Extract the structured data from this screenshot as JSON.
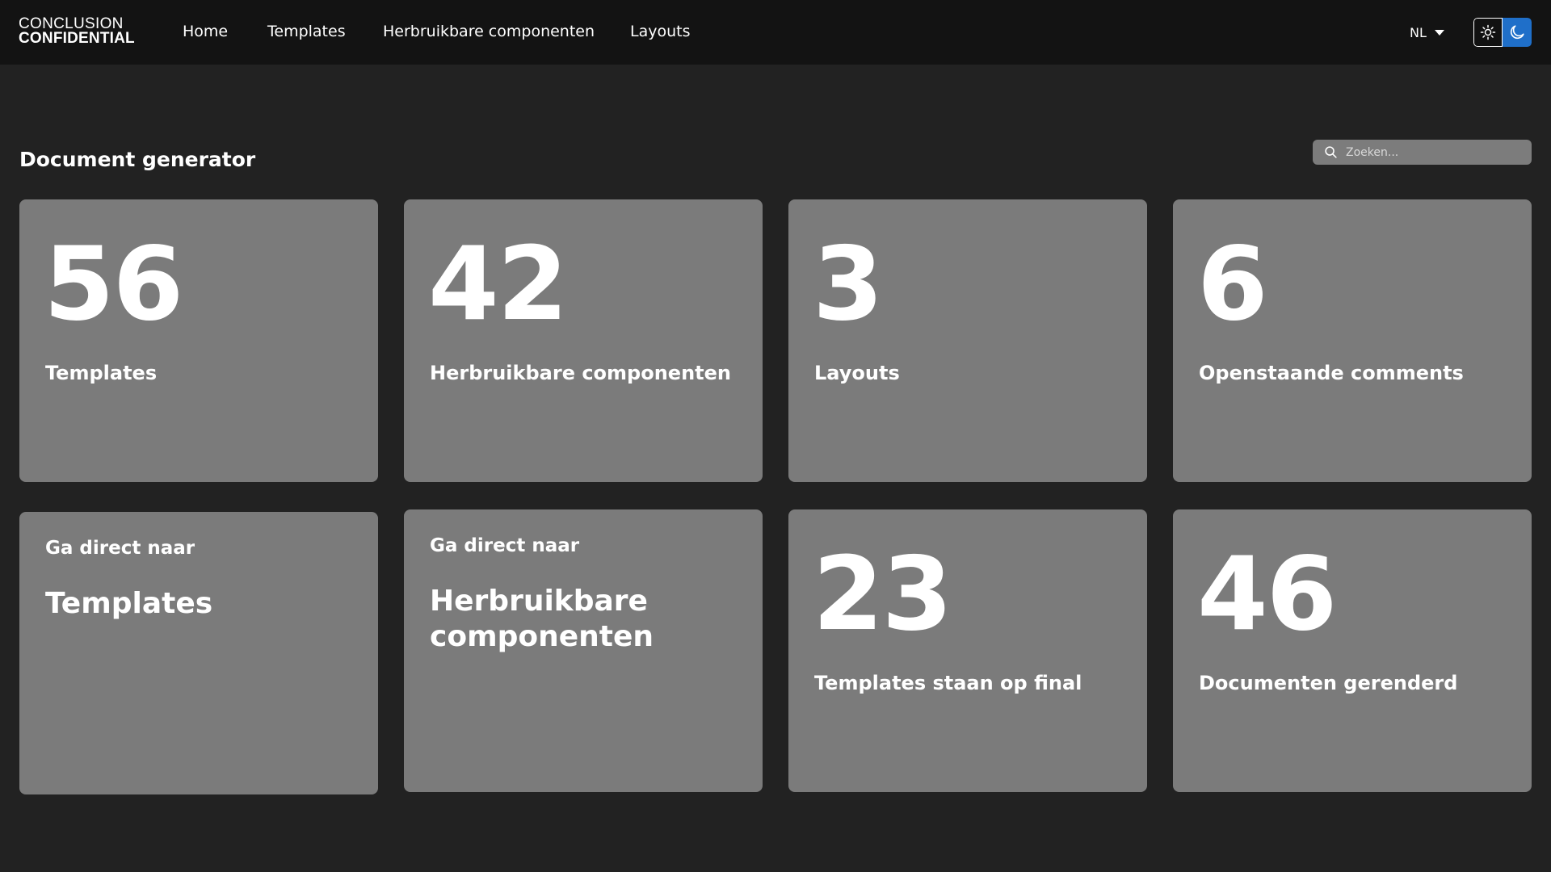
{
  "header": {
    "logo_line1": "CONCLUSION",
    "logo_line2": "CONFIDENTIAL",
    "nav": [
      {
        "label": "Home"
      },
      {
        "label": "Templates"
      },
      {
        "label": "Herbruikbare componenten"
      },
      {
        "label": "Layouts"
      }
    ],
    "language": "NL",
    "theme": {
      "active": "dark",
      "light_icon": "sun-icon",
      "dark_icon": "moon-icon",
      "accent": "#1f6fc9"
    }
  },
  "page": {
    "title": "Document generator"
  },
  "search": {
    "placeholder": "Zoeken...",
    "value": ""
  },
  "stats": [
    {
      "value": "56",
      "label": "Templates"
    },
    {
      "value": "42",
      "label": "Herbruikbare componenten"
    },
    {
      "value": "3",
      "label": "Layouts"
    },
    {
      "value": "6",
      "label": "Openstaande comments"
    }
  ],
  "shortcuts": [
    {
      "prefix": "Ga direct naar",
      "target": "Templates"
    },
    {
      "prefix": "Ga direct naar",
      "target": "Herbruikbare componenten"
    }
  ],
  "stats2": [
    {
      "value": "23",
      "label": "Templates staan op final"
    },
    {
      "value": "46",
      "label": "Documenten gerenderd"
    }
  ],
  "colors": {
    "background": "#222222",
    "topbar": "#131313",
    "card": "#7b7b7b",
    "text": "#ffffff"
  }
}
